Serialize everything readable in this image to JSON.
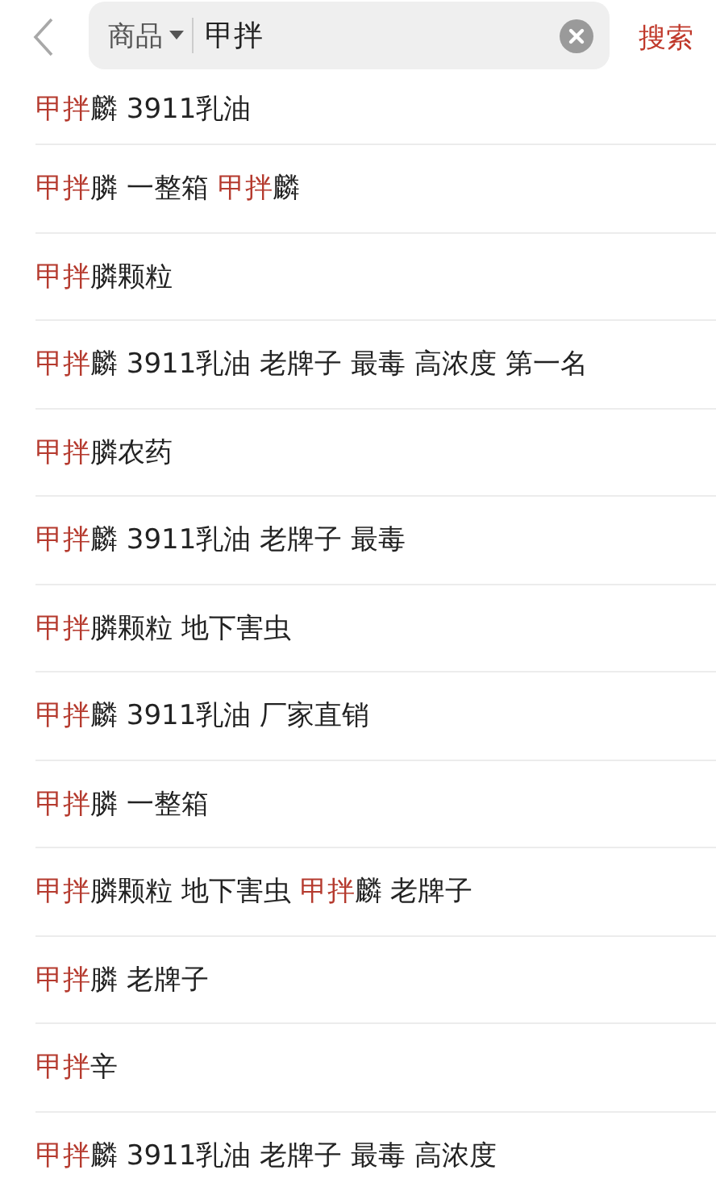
{
  "search": {
    "scope": "商品",
    "value": "甲拌",
    "action": "搜索"
  },
  "suggestions": [
    [
      {
        "text": "甲拌",
        "highlight": true
      },
      {
        "text": "麟 3911乳油",
        "highlight": false
      }
    ],
    [
      {
        "text": "甲拌",
        "highlight": true
      },
      {
        "text": "膦 一整箱 ",
        "highlight": false
      },
      {
        "text": "甲拌",
        "highlight": true
      },
      {
        "text": "麟",
        "highlight": false
      }
    ],
    [
      {
        "text": "甲拌",
        "highlight": true
      },
      {
        "text": "膦颗粒",
        "highlight": false
      }
    ],
    [
      {
        "text": "甲拌",
        "highlight": true
      },
      {
        "text": "麟 3911乳油 老牌子 最毒 高浓度 第一名",
        "highlight": false
      }
    ],
    [
      {
        "text": "甲拌",
        "highlight": true
      },
      {
        "text": "膦农药",
        "highlight": false
      }
    ],
    [
      {
        "text": "甲拌",
        "highlight": true
      },
      {
        "text": "麟 3911乳油 老牌子 最毒",
        "highlight": false
      }
    ],
    [
      {
        "text": "甲拌",
        "highlight": true
      },
      {
        "text": "膦颗粒 地下害虫",
        "highlight": false
      }
    ],
    [
      {
        "text": "甲拌",
        "highlight": true
      },
      {
        "text": "麟 3911乳油 厂家直销",
        "highlight": false
      }
    ],
    [
      {
        "text": "甲拌",
        "highlight": true
      },
      {
        "text": "膦 一整箱",
        "highlight": false
      }
    ],
    [
      {
        "text": "甲拌",
        "highlight": true
      },
      {
        "text": "膦颗粒 地下害虫 ",
        "highlight": false
      },
      {
        "text": "甲拌",
        "highlight": true
      },
      {
        "text": "麟 老牌子",
        "highlight": false
      }
    ],
    [
      {
        "text": "甲拌",
        "highlight": true
      },
      {
        "text": "膦 老牌子",
        "highlight": false
      }
    ],
    [
      {
        "text": "甲拌",
        "highlight": true
      },
      {
        "text": "辛",
        "highlight": false
      }
    ],
    [
      {
        "text": "甲拌",
        "highlight": true
      },
      {
        "text": "麟 3911乳油 老牌子 最毒 高浓度",
        "highlight": false
      }
    ]
  ]
}
